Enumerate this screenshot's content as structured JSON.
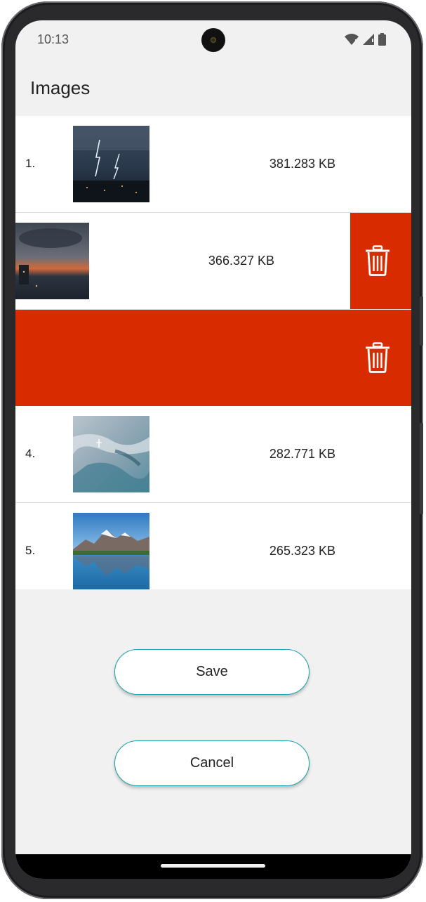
{
  "status_bar": {
    "time": "10:13",
    "icons": [
      "wifi-icon",
      "signal-icon",
      "battery-icon"
    ]
  },
  "app_bar": {
    "title": "Images"
  },
  "images": [
    {
      "index": "1.",
      "size": "381.283 KB",
      "thumbnail": "stormy-city-lightning"
    },
    {
      "index": "",
      "size": "366.327 KB",
      "thumbnail": "harbor-sunset-clouds",
      "state": "swiped-partial"
    },
    {
      "index": "",
      "size": "",
      "thumbnail": "",
      "state": "swiped-full"
    },
    {
      "index": "4.",
      "size": "282.771 KB",
      "thumbnail": "aerial-glacier-plane"
    },
    {
      "index": "5.",
      "size": "265.323 KB",
      "thumbnail": "mountain-lake-reflection"
    }
  ],
  "actions": {
    "save_label": "Save",
    "cancel_label": "Cancel"
  },
  "colors": {
    "delete": "#d92b00",
    "button_border": "#1aa1a8",
    "background": "#f1f1f1"
  }
}
